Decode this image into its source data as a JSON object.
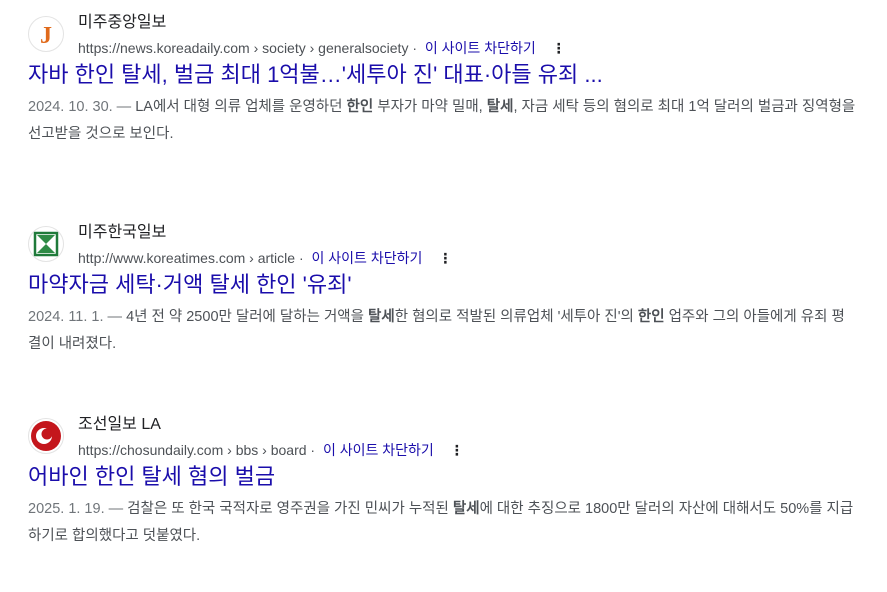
{
  "results": [
    {
      "site_name": "미주중앙일보",
      "url": "https://news.koreadaily.com",
      "path": " › society › generalsociety",
      "block_label": "이 사이트 차단하기",
      "title": "자바 한인 탈세, 벌금 최대 1억불…'세투아 진' 대표·아들 유죄 ...",
      "date": "2024. 10. 30. — ",
      "snippet_parts": [
        {
          "t": "LA에서 대형 의류 업체를 운영하던 "
        },
        {
          "t": "한인",
          "b": true
        },
        {
          "t": " 부자가 마약 밀매, "
        },
        {
          "t": "탈세",
          "b": true
        },
        {
          "t": ", 자금 세탁 등의 혐의로 최대 1억 달러의 벌금과 징역형을 선고받을 것으로 보인다."
        }
      ],
      "favicon": "koreadaily-j-icon"
    },
    {
      "site_name": "미주한국일보",
      "url": "http://www.koreatimes.com",
      "path": " › article",
      "block_label": "이 사이트 차단하기",
      "title": "마약자금 세탁·거액 탈세 한인 '유죄'",
      "date": "2024. 11. 1. — ",
      "snippet_parts": [
        {
          "t": "4년 전 약 2500만 달러에 달하는 거액을 "
        },
        {
          "t": "탈세",
          "b": true
        },
        {
          "t": "한 혐의로 적발된 의류업체 '세투아 진'의 "
        },
        {
          "t": "한인",
          "b": true
        },
        {
          "t": " 업주와 그의 아들에게 유죄 평결이 내려졌다."
        }
      ],
      "favicon": "koreatimes-hourglass-icon"
    },
    {
      "site_name": "조선일보 LA",
      "url": "https://chosundaily.com",
      "path": " › bbs › board",
      "block_label": "이 사이트 차단하기",
      "title": "어바인 한인 탈세 혐의 벌금",
      "date": "2025. 1. 19. — ",
      "snippet_parts": [
        {
          "t": "검찰은 또 한국 국적자로 영주권을 가진 민씨가 누적된 "
        },
        {
          "t": "탈세",
          "b": true
        },
        {
          "t": "에 대한 추징으로 1800만 달러의 자산에 대해서도 50%를 지급하기로 합의했다고 덧붙였다."
        }
      ],
      "favicon": "chosun-red-swirl-icon"
    }
  ],
  "more_icon": "⋮",
  "dot_sep": "·",
  "colors": {
    "link": "#1a0dab",
    "text": "#202124",
    "muted": "#4d5156"
  }
}
